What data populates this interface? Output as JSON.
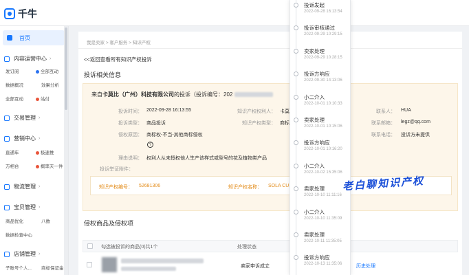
{
  "app": {
    "name": "千牛"
  },
  "sidebar": {
    "home": "首页",
    "groups": [
      {
        "label": "内容运营中心",
        "subs": [
          "发订阅",
          "全部互动",
          "数据概况",
          "效果分析",
          "全部互动",
          "站付"
        ]
      },
      {
        "label": "交易管理"
      },
      {
        "label": "营销中心",
        "subs": [
          "直通车",
          "极速推",
          "万相台",
          "概率天一件"
        ]
      },
      {
        "label": "物流管理"
      },
      {
        "label": "宝贝管理",
        "subs": [
          "商品优化",
          "八数",
          "数据检查中心"
        ]
      },
      {
        "label": "店铺管理",
        "subs": [
          "子账号个人...",
          "商标保证金"
        ]
      }
    ]
  },
  "breadcrumb": [
    "我是卖家",
    "客户服务",
    "知识产权"
  ],
  "back_link": "<<返回查看所有知识产权投诉",
  "section_complaint": "投诉相关信息",
  "card": {
    "head_prefix": "来自",
    "company": "卡莫比（广州）科技有限公司",
    "head_mid": "的投诉（投诉编号：202",
    "fields": {
      "time_label": "投诉时间：",
      "time_value": "2022-09-28 16:13:55",
      "owner_label": "知识产权权利人：",
      "owner_value": "卡莫比（广州",
      "contact_label": "联系人：",
      "contact_value": "HUA",
      "type_label": "投诉类型：",
      "type_value": "商品投诉",
      "ip_type_label": "知识产权类型：",
      "ip_type_value": "商标权",
      "email_label": "联系邮箱：",
      "email_value": "legz@qq.com",
      "reason_label": "侵权原因：",
      "reason_value": "商标权-不当-其他商标侵权",
      "phone_label": "联系电话：",
      "phone_value": "投诉方未提供",
      "explain_label": "理由说明：",
      "explain_value": "权利人从未授权他人生产该样式或型号的花及植物类产品",
      "evidence_label": "投诉举证附件："
    },
    "ip_no_label": "知识产权编号：",
    "ip_no_value": "52681306",
    "ip_name_label": "知识产权名称：",
    "ip_name_value": "SOLA CUBE"
  },
  "section_goods": "侵权商品及侵权项",
  "table": {
    "select_all": "勾选被投诉的商品(0)共1个",
    "col_status": "处理状态",
    "row_status": "卖家申诉成立",
    "row_action": "历史处理"
  },
  "timeline": [
    {
      "title": "投诉发起",
      "time": "2022-09-28 16:13:54"
    },
    {
      "title": "投诉审核通过",
      "time": "2022-09-29 10:29:15"
    },
    {
      "title": "卖家处理",
      "time": "2022-09-29 10:28:15"
    },
    {
      "title": "投诉方响应",
      "time": "2022-09-30 14:13:06"
    },
    {
      "title": "小二介入",
      "time": "2022-10-01 10:10:33"
    },
    {
      "title": "卖家处理",
      "time": "2022-10-01 10:15:06"
    },
    {
      "title": "投诉方响应",
      "time": "2022-10-01 10:16:20"
    },
    {
      "title": "小二介入",
      "time": "2022-10-02 15:35:06"
    },
    {
      "title": "卖家处理",
      "time": "2022-10-10 11:11:16"
    },
    {
      "title": "小二介入",
      "time": "2022-10-10 11:35:09"
    },
    {
      "title": "卖家处理",
      "time": "2022-10-11 11:35:05"
    },
    {
      "title": "投诉方响应",
      "time": "2022-10-13 11:35:06"
    }
  ],
  "watermark": "老白聊知识产权",
  "colors": {
    "accent": "#1677ff",
    "card_bg": "#fdf6ea",
    "ip_text": "#e38b18",
    "watermark": "#1a4fd8"
  }
}
